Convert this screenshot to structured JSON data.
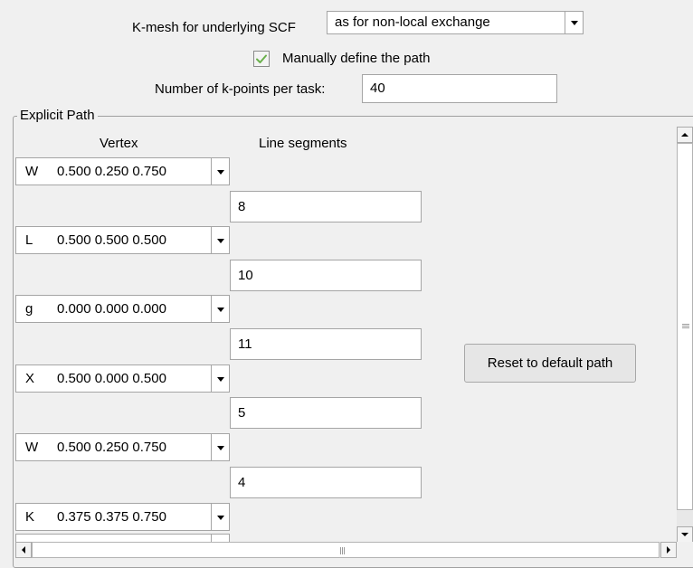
{
  "kmesh": {
    "label": "K-mesh for underlying SCF",
    "selected": "as for non-local exchange"
  },
  "manual_path": {
    "label": "Manually define the path",
    "checked": true
  },
  "kpoints": {
    "label": "Number of k-points per task:",
    "value": "40"
  },
  "explicit_path": {
    "title": "Explicit Path",
    "vertex_header": "Vertex",
    "segments_header": "Line segments",
    "vertices": [
      {
        "label": "W",
        "coords": "0.500 0.250 0.750"
      },
      {
        "label": "L",
        "coords": "0.500 0.500 0.500"
      },
      {
        "label": "g",
        "coords": "0.000 0.000 0.000"
      },
      {
        "label": "X",
        "coords": "0.500 0.000 0.500"
      },
      {
        "label": "W",
        "coords": "0.500 0.250 0.750"
      },
      {
        "label": "K",
        "coords": "0.375 0.375 0.750"
      }
    ],
    "segments": [
      "8",
      "10",
      "11",
      "5",
      "4"
    ],
    "reset_button": "Reset to default path"
  }
}
